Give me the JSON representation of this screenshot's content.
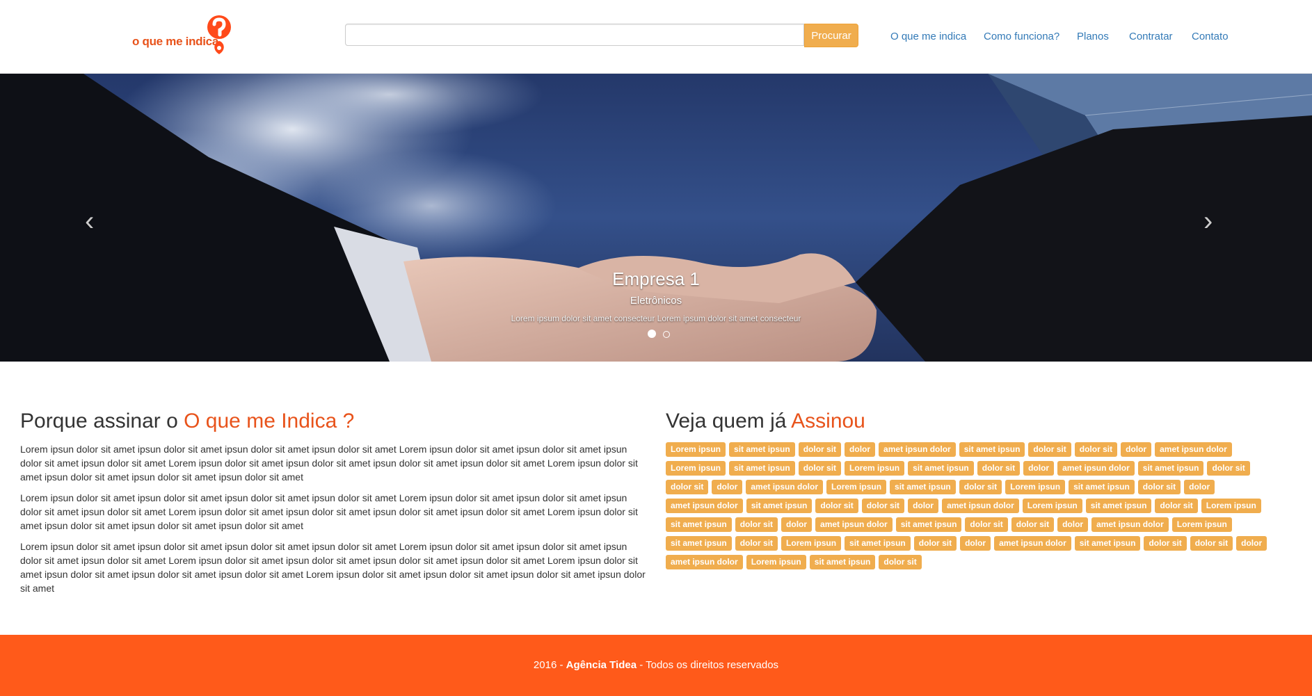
{
  "brand": {
    "logo_text": "o que me indica"
  },
  "search": {
    "placeholder": "",
    "button_label": "Procurar"
  },
  "nav": {
    "items": [
      "O que me indica",
      "Como funciona?",
      "Planos",
      "Contratar",
      "Contato"
    ]
  },
  "carousel": {
    "title": "Empresa 1",
    "subtitle": "Eletrônicos",
    "description": "Lorem ipsum dolor sit amet consecteur Lorem ipsum dolor sit amet consecteur",
    "prev_glyph": "‹",
    "next_glyph": "›"
  },
  "why": {
    "title_prefix": "Porque assinar o ",
    "title_accent": "O que me Indica ?",
    "paragraphs": [
      "Lorem ipsun dolor sit amet ipsun dolor sit amet ipsun dolor sit amet ipsun dolor sit amet Lorem ipsun dolor sit amet ipsun dolor sit amet ipsun dolor sit amet ipsun dolor sit amet Lorem ipsun dolor sit amet ipsun dolor sit amet ipsun dolor sit amet ipsun dolor sit amet Lorem ipsun dolor sit amet ipsun dolor sit amet ipsun dolor sit amet ipsun dolor sit amet",
      "Lorem ipsun dolor sit amet ipsun dolor sit amet ipsun dolor sit amet ipsun dolor sit amet Lorem ipsun dolor sit amet ipsun dolor sit amet ipsun dolor sit amet ipsun dolor sit amet Lorem ipsun dolor sit amet ipsun dolor sit amet ipsun dolor sit amet ipsun dolor sit amet Lorem ipsun dolor sit amet ipsun dolor sit amet ipsun dolor sit amet ipsun dolor sit amet",
      "Lorem ipsun dolor sit amet ipsun dolor sit amet ipsun dolor sit amet ipsun dolor sit amet Lorem ipsun dolor sit amet ipsun dolor sit amet ipsun dolor sit amet ipsun dolor sit amet Lorem ipsun dolor sit amet ipsun dolor sit amet ipsun dolor sit amet ipsun dolor sit amet Lorem ipsun dolor sit amet ipsun dolor sit amet ipsun dolor sit amet ipsun dolor sit amet Lorem ipsun dolor sit amet ipsun dolor sit amet ipsun dolor sit amet ipsun dolor sit amet"
    ]
  },
  "subscribers": {
    "title_prefix": "Veja quem já ",
    "title_accent": "Assinou",
    "tags": [
      "Lorem ipsun",
      "sit amet ipsun",
      "dolor sit",
      "dolor",
      "amet ipsun dolor",
      "sit amet ipsun",
      "dolor sit",
      "dolor sit",
      "dolor",
      "amet ipsun dolor",
      "Lorem ipsun",
      "sit amet ipsun",
      "dolor sit",
      "Lorem ipsun",
      "sit amet ipsun",
      "dolor sit",
      "dolor",
      "amet ipsun dolor",
      "sit amet ipsun",
      "dolor sit",
      "dolor sit",
      "dolor",
      "amet ipsun dolor",
      "Lorem ipsun",
      "sit amet ipsun",
      "dolor sit",
      "Lorem ipsun",
      "sit amet ipsun",
      "dolor sit",
      "dolor",
      "amet ipsun dolor",
      "sit amet ipsun",
      "dolor sit",
      "dolor sit",
      "dolor",
      "amet ipsun dolor",
      "Lorem ipsun",
      "sit amet ipsun",
      "dolor sit",
      "Lorem ipsun",
      "sit amet ipsun",
      "dolor sit",
      "dolor",
      "amet ipsun dolor",
      "sit amet ipsun",
      "dolor sit",
      "dolor sit",
      "dolor",
      "amet ipsun dolor",
      "Lorem ipsun",
      "sit amet ipsun",
      "dolor sit",
      "Lorem ipsun",
      "sit amet ipsun",
      "dolor sit",
      "dolor",
      "amet ipsun dolor",
      "sit amet ipsun",
      "dolor sit",
      "dolor sit",
      "dolor",
      "amet ipsun dolor",
      "Lorem ipsun",
      "sit amet ipsun",
      "dolor sit"
    ]
  },
  "footer": {
    "year": "2016 - ",
    "agency": "Agência Tidea",
    "rights": " - Todos os direitos reservados"
  },
  "colors": {
    "accent": "#e8531b",
    "tag": "#f0ad4e",
    "footer": "#ff5a1a",
    "link": "#337ab7"
  }
}
